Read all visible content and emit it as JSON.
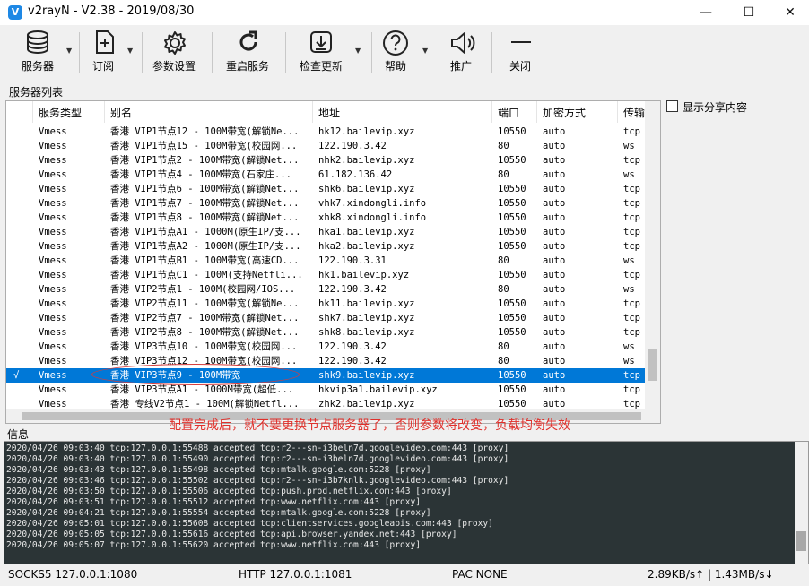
{
  "window": {
    "title": "v2rayN - V2.38 - 2019/08/30",
    "app_icon": "V"
  },
  "toolbar": {
    "servers": "服务器",
    "subscribe": "订阅",
    "settings": "参数设置",
    "restart": "重启服务",
    "update": "检查更新",
    "help": "帮助",
    "promote": "推广",
    "close": "关闭"
  },
  "server_list_label": "服务器列表",
  "table": {
    "headers": [
      "服务类型",
      "别名",
      "地址",
      "端口",
      "加密方式",
      "传输协"
    ],
    "rows": [
      {
        "check": "",
        "type": "Vmess",
        "alias": "香港 VIP1节点12 - 100M带宽(解锁Ne...",
        "addr": "hk12.bailevip.xyz",
        "port": "10550",
        "enc": "auto",
        "net": "tcp"
      },
      {
        "check": "",
        "type": "Vmess",
        "alias": "香港 VIP1节点15 - 100M带宽(校园网...",
        "addr": "122.190.3.42",
        "port": "80",
        "enc": "auto",
        "net": "ws"
      },
      {
        "check": "",
        "type": "Vmess",
        "alias": "香港 VIP1节点2 - 100M带宽(解锁Net...",
        "addr": "nhk2.bailevip.xyz",
        "port": "10550",
        "enc": "auto",
        "net": "tcp"
      },
      {
        "check": "",
        "type": "Vmess",
        "alias": "香港 VIP1节点4 - 100M带宽(石家庄...",
        "addr": "61.182.136.42",
        "port": "80",
        "enc": "auto",
        "net": "ws"
      },
      {
        "check": "",
        "type": "Vmess",
        "alias": "香港 VIP1节点6 - 100M带宽(解锁Net...",
        "addr": "shk6.bailevip.xyz",
        "port": "10550",
        "enc": "auto",
        "net": "tcp"
      },
      {
        "check": "",
        "type": "Vmess",
        "alias": "香港 VIP1节点7 - 100M带宽(解锁Net...",
        "addr": "vhk7.xindongli.info",
        "port": "10550",
        "enc": "auto",
        "net": "tcp"
      },
      {
        "check": "",
        "type": "Vmess",
        "alias": "香港 VIP1节点8 - 100M带宽(解锁Net...",
        "addr": "xhk8.xindongli.info",
        "port": "10550",
        "enc": "auto",
        "net": "tcp"
      },
      {
        "check": "",
        "type": "Vmess",
        "alias": "香港 VIP1节点A1 - 1000M(原生IP/支...",
        "addr": "hka1.bailevip.xyz",
        "port": "10550",
        "enc": "auto",
        "net": "tcp"
      },
      {
        "check": "",
        "type": "Vmess",
        "alias": "香港 VIP1节点A2 - 1000M(原生IP/支...",
        "addr": "hka2.bailevip.xyz",
        "port": "10550",
        "enc": "auto",
        "net": "tcp"
      },
      {
        "check": "",
        "type": "Vmess",
        "alias": "香港 VIP1节点B1 - 100M带宽(高速CD...",
        "addr": "122.190.3.31",
        "port": "80",
        "enc": "auto",
        "net": "ws"
      },
      {
        "check": "",
        "type": "Vmess",
        "alias": "香港 VIP1节点C1 - 100M(支持Netfli...",
        "addr": "hk1.bailevip.xyz",
        "port": "10550",
        "enc": "auto",
        "net": "tcp"
      },
      {
        "check": "",
        "type": "Vmess",
        "alias": "香港 VIP2节点1 - 100M(校园网/IOS...",
        "addr": "122.190.3.42",
        "port": "80",
        "enc": "auto",
        "net": "ws"
      },
      {
        "check": "",
        "type": "Vmess",
        "alias": "香港 VIP2节点11 - 100M带宽(解锁Ne...",
        "addr": "hk11.bailevip.xyz",
        "port": "10550",
        "enc": "auto",
        "net": "tcp"
      },
      {
        "check": "",
        "type": "Vmess",
        "alias": "香港 VIP2节点7 - 100M带宽(解锁Net...",
        "addr": "shk7.bailevip.xyz",
        "port": "10550",
        "enc": "auto",
        "net": "tcp"
      },
      {
        "check": "",
        "type": "Vmess",
        "alias": "香港 VIP2节点8 - 100M带宽(解锁Net...",
        "addr": "shk8.bailevip.xyz",
        "port": "10550",
        "enc": "auto",
        "net": "tcp"
      },
      {
        "check": "",
        "type": "Vmess",
        "alias": "香港 VIP3节点10 - 100M带宽(校园网...",
        "addr": "122.190.3.42",
        "port": "80",
        "enc": "auto",
        "net": "ws"
      },
      {
        "check": "",
        "type": "Vmess",
        "alias": "香港 VIP3节点12 - 100M带宽(校园网...",
        "addr": "122.190.3.42",
        "port": "80",
        "enc": "auto",
        "net": "ws"
      },
      {
        "check": "√",
        "type": "Vmess",
        "alias": "香港 VIP3节点9 - 100M带宽",
        "addr": "shk9.bailevip.xyz",
        "port": "10550",
        "enc": "auto",
        "net": "tcp",
        "selected": true
      },
      {
        "check": "",
        "type": "Vmess",
        "alias": "香港 VIP3节点A1 - 1000M带宽(超低...",
        "addr": "hkvip3a1.bailevip.xyz",
        "port": "10550",
        "enc": "auto",
        "net": "tcp"
      },
      {
        "check": "",
        "type": "Vmess",
        "alias": "香港 专线V2节点1 - 100M(解锁Netfl...",
        "addr": "zhk2.bailevip.xyz",
        "port": "10550",
        "enc": "auto",
        "net": "tcp"
      }
    ]
  },
  "share_label": "显示分享内容",
  "annotation": "配置完成后，就不要更换节点服务器了，否则参数将改变，负载均衡失效",
  "info_label": "信息",
  "log": [
    "2020/04/26 09:03:40 tcp:127.0.0.1:55488 accepted tcp:r2---sn-i3beln7d.googlevideo.com:443 [proxy]",
    "2020/04/26 09:03:40 tcp:127.0.0.1:55490 accepted tcp:r2---sn-i3beln7d.googlevideo.com:443 [proxy]",
    "2020/04/26 09:03:43 tcp:127.0.0.1:55498 accepted tcp:mtalk.google.com:5228 [proxy]",
    "2020/04/26 09:03:46 tcp:127.0.0.1:55502 accepted tcp:r2---sn-i3b7knlk.googlevideo.com:443 [proxy]",
    "2020/04/26 09:03:50 tcp:127.0.0.1:55506 accepted tcp:push.prod.netflix.com:443 [proxy]",
    "2020/04/26 09:03:51 tcp:127.0.0.1:55512 accepted tcp:www.netflix.com:443 [proxy]",
    "2020/04/26 09:04:21 tcp:127.0.0.1:55554 accepted tcp:mtalk.google.com:5228 [proxy]",
    "2020/04/26 09:05:01 tcp:127.0.0.1:55608 accepted tcp:clientservices.googleapis.com:443 [proxy]",
    "2020/04/26 09:05:05 tcp:127.0.0.1:55616 accepted tcp:api.browser.yandex.net:443 [proxy]",
    "2020/04/26 09:05:07 tcp:127.0.0.1:55620 accepted tcp:www.netflix.com:443 [proxy]"
  ],
  "status": {
    "socks": "SOCKS5  127.0.0.1:1080",
    "http": "HTTP  127.0.0.1:1081",
    "pac": "PAC  NONE",
    "speed": "2.89KB/s↑ | 1.43MB/s↓"
  },
  "colors": {
    "selection": "#0078d7",
    "annotation": "#e0302b",
    "log_bg": "#2b3436"
  }
}
